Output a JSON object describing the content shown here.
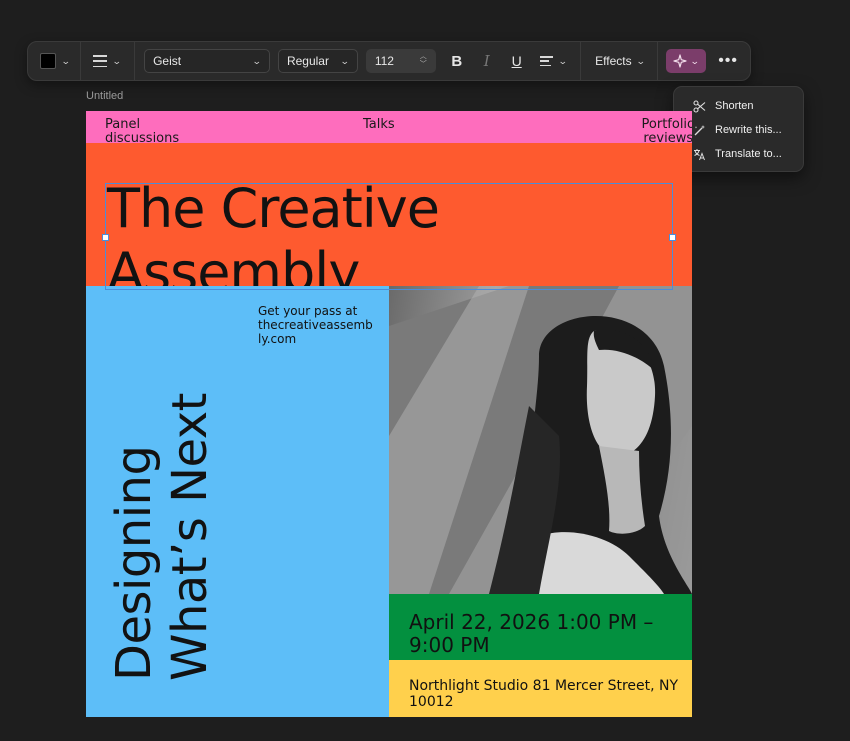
{
  "toolbar": {
    "fill_color": "#000000",
    "font_family": "Geist",
    "font_weight": "Regular",
    "font_size": "112",
    "bold_label": "B",
    "italic_label": "I",
    "underline_label": "U",
    "effects_label": "Effects",
    "more_label": "•••"
  },
  "ai_menu": {
    "items": [
      {
        "label": "Shorten",
        "icon": "scissors-icon"
      },
      {
        "label": "Rewrite this...",
        "icon": "magic-wand-icon"
      },
      {
        "label": "Translate to...",
        "icon": "translate-icon"
      }
    ]
  },
  "document": {
    "title": "Untitled"
  },
  "poster": {
    "nav": {
      "panel": "Panel\ndiscussions",
      "talks": "Talks",
      "portfolio": "Portfolio\nreviews"
    },
    "headline": "The Creative\nAssembly",
    "pass": "Get your pass at\nthecreativeassemb\nly.com",
    "vertical": "Designing\nWhat’s Next",
    "date": "April 22, 2026 1:00 PM –\n9:00 PM",
    "venue": "Northlight Studio 81 Mercer Street, NY\n10012",
    "colors": {
      "pink": "#fe6dbd",
      "orange": "#fe5a2f",
      "blue": "#5dbef8",
      "green": "#03903f",
      "yellow": "#ffd04c"
    }
  }
}
